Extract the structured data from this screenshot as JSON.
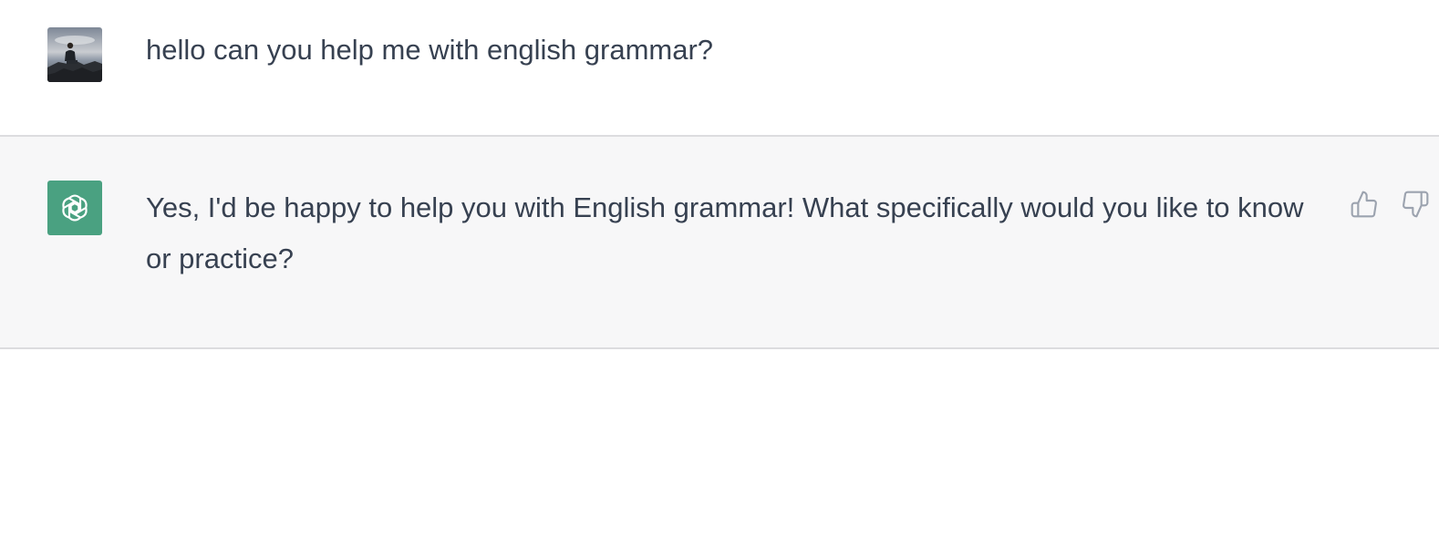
{
  "conversation": {
    "messages": [
      {
        "role": "user",
        "text": "hello can you help me with english grammar?",
        "avatar_icon": "user-photo-avatar"
      },
      {
        "role": "assistant",
        "text": "Yes, I'd be happy to help you with English grammar! What specifically would you like to know or practice?",
        "avatar_icon": "openai-logo-icon",
        "avatar_color": "#4aa181",
        "feedback": {
          "like_icon": "thumbs-up-icon",
          "dislike_icon": "thumbs-down-icon"
        }
      }
    ]
  },
  "colors": {
    "text": "#374151",
    "assistant_bg": "#f7f7f8",
    "divider": "#dcdcdf",
    "icon": "#9ca3af"
  }
}
